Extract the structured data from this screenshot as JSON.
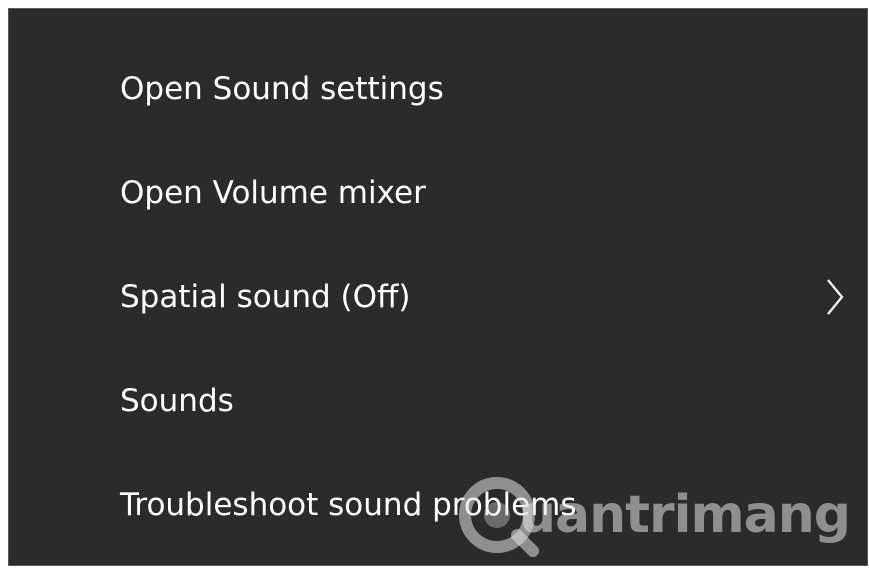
{
  "context_menu": {
    "items": [
      {
        "label": "Open Sound settings",
        "has_submenu": false
      },
      {
        "label": "Open Volume mixer",
        "has_submenu": false
      },
      {
        "label": "Spatial sound (Off)",
        "has_submenu": true
      },
      {
        "label": "Sounds",
        "has_submenu": false
      },
      {
        "label": "Troubleshoot sound problems",
        "has_submenu": false
      }
    ],
    "submenu_icon": "chevron-right-icon"
  },
  "watermark": {
    "text": "uantrimang",
    "logo_icon": "quantrimang-logo-icon"
  },
  "colors": {
    "menu_background": "#2b2b2b",
    "menu_text": "#ffffff",
    "menu_border": "#5a5a5a"
  }
}
